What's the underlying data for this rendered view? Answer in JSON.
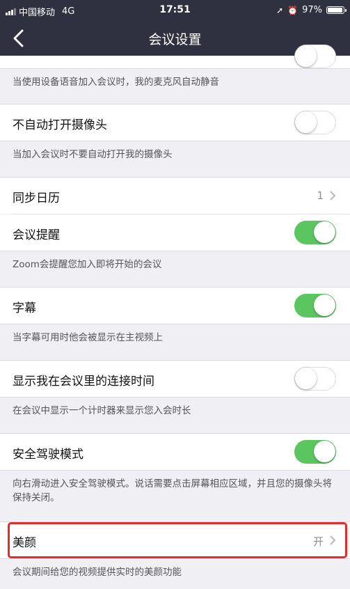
{
  "status_bar": {
    "carrier": "中国移动",
    "network": "4G",
    "time": "17:51",
    "battery": "97%"
  },
  "nav": {
    "title": "会议设置",
    "back_icon": "chevron-left-icon"
  },
  "settings": {
    "mute_mic_desc": "当使用设备语音加入会议时，我的麦克风自动静音",
    "no_camera": {
      "label": "不自动打开摄像头",
      "on": false,
      "desc": "当加入会议时不要自动打开我的摄像头"
    },
    "sync_calendar": {
      "label": "同步日历",
      "value": "1"
    },
    "meeting_reminder": {
      "label": "会议提醒",
      "on": true,
      "desc": "Zoom会提醒您加入即将开始的会议"
    },
    "captions": {
      "label": "字幕",
      "on": true,
      "desc": "当字幕可用时他会被显示在主视频上"
    },
    "show_connect_time": {
      "label": "显示我在会议里的连接时间",
      "on": false,
      "desc": "在会议中显示一个计时器来显示您入会时长"
    },
    "safe_driving": {
      "label": "安全驾驶模式",
      "on": true,
      "desc": "向右滑动进入安全驾驶模式。说话需要点击屏幕相应区域，并且您的摄像头将保持关闭。"
    },
    "beauty": {
      "label": "美颜",
      "value": "开",
      "desc": "会议期间给您的视频提供实时的美颜功能"
    }
  },
  "colors": {
    "nav_bg": "#2f3140",
    "toggle_on": "#5bc65f",
    "highlight": "#e52a2a"
  }
}
